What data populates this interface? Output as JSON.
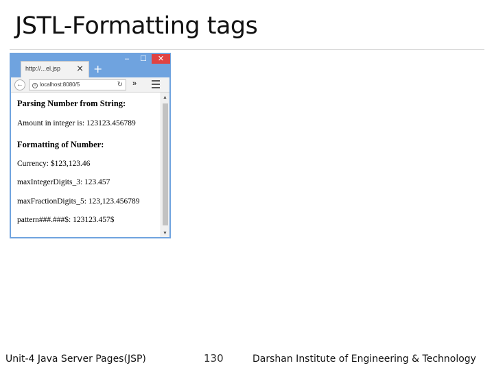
{
  "slide": {
    "title": "JSTL-Formatting tags"
  },
  "browser": {
    "tab_title": "http://...el.jsp",
    "url": "localhost:8080/5",
    "content": {
      "heading1": "Parsing Number from String:",
      "line1": "Amount in integer is: 123123.456789",
      "heading2": "Formatting of Number:",
      "line2": "Currency: $123,123.46",
      "line3": "maxIntegerDigits_3: 123.457",
      "line4": "maxFractionDigits_5: 123,123.456789",
      "line5": "pattern###.###$: 123123.457$"
    }
  },
  "footer": {
    "left": "Unit-4 Java Server Pages(JSP)",
    "page": "130",
    "right": "Darshan Institute of Engineering & Technology"
  }
}
